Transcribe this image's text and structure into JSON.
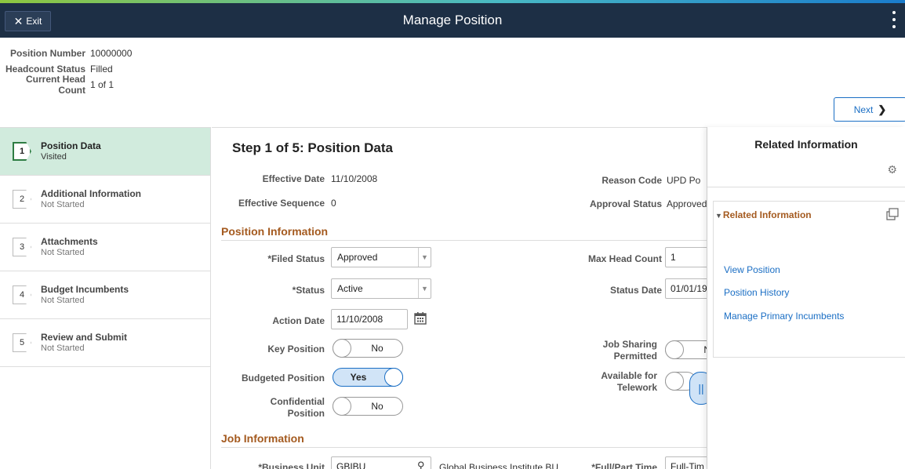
{
  "header": {
    "exit_label": "Exit",
    "title": "Manage Position"
  },
  "summary": [
    {
      "label": "Position Number",
      "value": "10000000"
    },
    {
      "label": "Headcount Status",
      "value": "Filled"
    },
    {
      "label": "Current Head Count",
      "value": "1 of 1"
    }
  ],
  "next_label": "Next",
  "steps": [
    {
      "num": "1",
      "title": "Position Data",
      "status": "Visited"
    },
    {
      "num": "2",
      "title": "Additional Information",
      "status": "Not Started"
    },
    {
      "num": "3",
      "title": "Attachments",
      "status": "Not Started"
    },
    {
      "num": "4",
      "title": "Budget Incumbents",
      "status": "Not Started"
    },
    {
      "num": "5",
      "title": "Review and Submit",
      "status": "Not Started"
    }
  ],
  "main": {
    "heading": "Step 1 of 5: Position Data",
    "effective_date_label": "Effective Date",
    "effective_date": "11/10/2008",
    "reason_code_label": "Reason Code",
    "reason_code": "UPD  Po",
    "effective_sequence_label": "Effective Sequence",
    "effective_sequence": "0",
    "approval_status_label": "Approval Status",
    "approval_status": "Approved",
    "position_info_section": "Position Information",
    "filed_status_label": "*Filed Status",
    "filed_status": "Approved",
    "max_head_count_label": "Max Head Count",
    "max_head_count": "1",
    "status_label": "*Status",
    "status": "Active",
    "status_date_label": "Status Date",
    "status_date": "01/01/19",
    "action_date_label": "Action Date",
    "action_date": "11/10/2008",
    "key_position_label": "Key Position",
    "key_position": "No",
    "job_sharing_label_1": "Job Sharing",
    "job_sharing_label_2": "Permitted",
    "job_sharing": "No",
    "budgeted_position_label": "Budgeted Position",
    "budgeted_position": "Yes",
    "telework_label_1": "Available for",
    "telework_label_2": "Telework",
    "confidential_label_1": "Confidential",
    "confidential_label_2": "Position",
    "confidential": "No",
    "job_info_section": "Job Information",
    "business_unit_label": "*Business Unit",
    "business_unit": "GBIBU",
    "business_unit_desc": "Global Business Institute BU",
    "full_part_label": "*Full/Part Time",
    "full_part": "Full-Tim"
  },
  "related": {
    "title": "Related Information",
    "box_title": "Related Information",
    "links": [
      "View Position",
      "Position History",
      "Manage Primary Incumbents"
    ]
  },
  "colors": {
    "banner": "#1d2f45",
    "active_step": "#d1ebdd",
    "section_title": "#a45a1f",
    "link": "#1a6ec4"
  }
}
